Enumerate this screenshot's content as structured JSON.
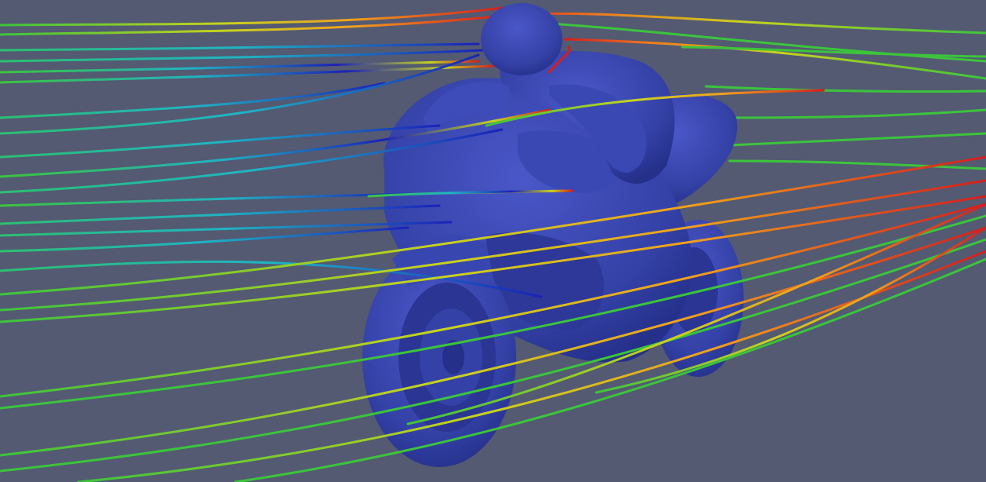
{
  "scene": {
    "background_color": "#535a72",
    "model_color": "#3441a6",
    "model_shadow_color": "#25308a",
    "model_highlight_color": "#4a57c8",
    "streamline_colors": [
      "#1a22b8",
      "#1e6fe0",
      "#1fb4c4",
      "#2cc070",
      "#3cc43c",
      "#c8d21e",
      "#f0a01e",
      "#e0521e",
      "#d41e1e"
    ]
  }
}
